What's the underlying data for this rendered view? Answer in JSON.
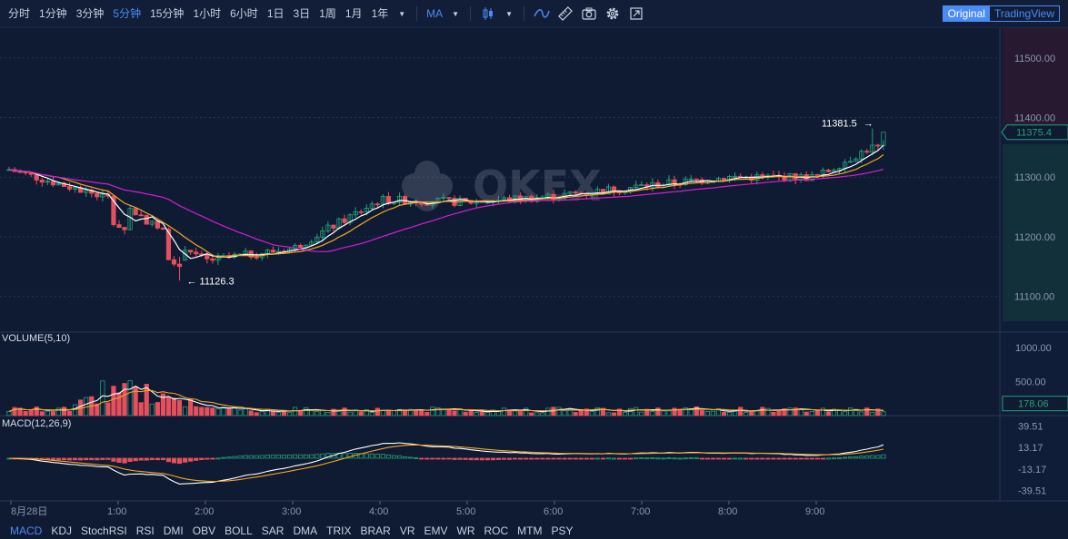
{
  "toolbar": {
    "periods": [
      {
        "label": "分时",
        "active": false
      },
      {
        "label": "1分钟",
        "active": false
      },
      {
        "label": "3分钟",
        "active": false
      },
      {
        "label": "5分钟",
        "active": true
      },
      {
        "label": "15分钟",
        "active": false
      },
      {
        "label": "1小时",
        "active": false
      },
      {
        "label": "6小时",
        "active": false
      },
      {
        "label": "1日",
        "active": false
      },
      {
        "label": "3日",
        "active": false
      },
      {
        "label": "1周",
        "active": false
      },
      {
        "label": "1月",
        "active": false
      },
      {
        "label": "1年",
        "active": false
      }
    ],
    "indicator_select": "MA",
    "view_original": "Original",
    "view_tradingview": "TradingView",
    "icons": [
      "caret-down-icon",
      "candle-type-icon",
      "line-style-icon",
      "ruler-icon",
      "camera-icon",
      "gear-icon",
      "fullscreen-icon"
    ]
  },
  "watermark": "OKEX",
  "price_axis": {
    "ticks": [
      "11500.00",
      "11400.00",
      "11300.00",
      "11200.00",
      "11100.00"
    ],
    "current_price": "11375.4",
    "high_label": "11381.5",
    "low_label": "11126.3",
    "high_value": 11381.5,
    "low_value": 11126.3,
    "current_value": 11375.4
  },
  "volume_pane": {
    "label": "VOLUME(5,10)",
    "ticks": [
      "1000.00",
      "500.00"
    ],
    "current": "178.06"
  },
  "macd_pane": {
    "label": "MACD(12,26,9)",
    "ticks": [
      "39.51",
      "13.17",
      "-13.17",
      "-39.51"
    ]
  },
  "time_axis": {
    "labels": [
      "8月28日",
      "1:00",
      "2:00",
      "3:00",
      "4:00",
      "5:00",
      "6:00",
      "7:00",
      "8:00",
      "9:00"
    ]
  },
  "indicators": [
    {
      "label": "MACD",
      "active": true
    },
    {
      "label": "KDJ",
      "active": false
    },
    {
      "label": "StochRSI",
      "active": false
    },
    {
      "label": "RSI",
      "active": false
    },
    {
      "label": "DMI",
      "active": false
    },
    {
      "label": "OBV",
      "active": false
    },
    {
      "label": "BOLL",
      "active": false
    },
    {
      "label": "SAR",
      "active": false
    },
    {
      "label": "DMA",
      "active": false
    },
    {
      "label": "TRIX",
      "active": false
    },
    {
      "label": "BRAR",
      "active": false
    },
    {
      "label": "VR",
      "active": false
    },
    {
      "label": "EMV",
      "active": false
    },
    {
      "label": "WR",
      "active": false
    },
    {
      "label": "ROC",
      "active": false
    },
    {
      "label": "MTM",
      "active": false
    },
    {
      "label": "PSY",
      "active": false
    }
  ],
  "colors": {
    "up": "#26a17b",
    "down": "#e5505c",
    "ma_fast": "#ffffff",
    "ma_mid": "#f5a623",
    "ma_slow": "#d020d0",
    "accent": "#4b8bf5",
    "background": "#0f1b33"
  },
  "chart_data": {
    "type": "candlestick",
    "interval": "5分钟",
    "key_points": [
      {
        "label": "8月28日",
        "price": 11312
      },
      {
        "label": "1:00",
        "price": 11260
      },
      {
        "label": "1:30",
        "price": 11160
      },
      {
        "label": "2:00",
        "price": 11180
      },
      {
        "label": "3:00",
        "price": 11262
      },
      {
        "label": "4:00",
        "price": 11258
      },
      {
        "label": "5:00",
        "price": 11268
      },
      {
        "label": "6:00",
        "price": 11285
      },
      {
        "label": "7:00",
        "price": 11300
      },
      {
        "label": "8:00",
        "price": 11300
      },
      {
        "label": "9:00",
        "price": 11350
      }
    ],
    "high": 11381.5,
    "low": 11126.3,
    "last": 11375.4,
    "ylim": [
      11040,
      11550
    ]
  }
}
